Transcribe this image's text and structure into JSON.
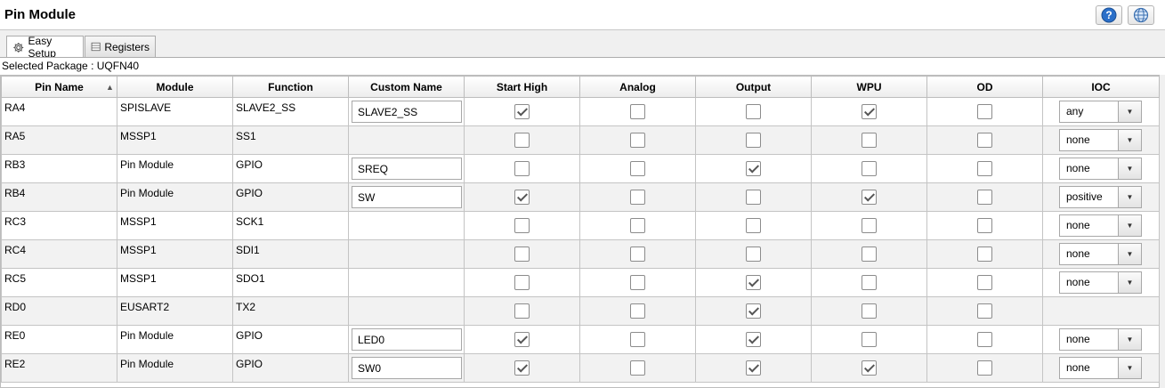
{
  "window": {
    "title": "Pin Module"
  },
  "toolbar": {
    "help_icon": "help-icon",
    "globe_icon": "globe-icon"
  },
  "tabs": [
    {
      "label": "Easy Setup",
      "icon": "gear-icon",
      "active": true
    },
    {
      "label": "Registers",
      "icon": "registers-icon",
      "active": false
    }
  ],
  "package": {
    "label": "Selected Package : UQFN40"
  },
  "columns": [
    "Pin Name",
    "Module",
    "Function",
    "Custom Name",
    "Start High",
    "Analog",
    "Output",
    "WPU",
    "OD",
    "IOC"
  ],
  "sort": {
    "column": "Pin Name",
    "direction": "ascending"
  },
  "rows": [
    {
      "pin": "RA4",
      "module": "SPISLAVE",
      "function": "SLAVE2_SS",
      "custom_name": "SLAVE2_SS",
      "start_high": true,
      "analog": false,
      "output": false,
      "wpu": true,
      "od": false,
      "ioc": "any"
    },
    {
      "pin": "RA5",
      "module": "MSSP1",
      "function": "SS1",
      "custom_name": null,
      "start_high": false,
      "analog": false,
      "output": false,
      "wpu": false,
      "od": false,
      "ioc": "none"
    },
    {
      "pin": "RB3",
      "module": "Pin Module",
      "function": "GPIO",
      "custom_name": "SREQ",
      "start_high": false,
      "analog": false,
      "output": true,
      "wpu": false,
      "od": false,
      "ioc": "none"
    },
    {
      "pin": "RB4",
      "module": "Pin Module",
      "function": "GPIO",
      "custom_name": "SW",
      "start_high": true,
      "analog": false,
      "output": false,
      "wpu": true,
      "od": false,
      "ioc": "positive"
    },
    {
      "pin": "RC3",
      "module": "MSSP1",
      "function": "SCK1",
      "custom_name": null,
      "start_high": false,
      "analog": false,
      "output": false,
      "wpu": false,
      "od": false,
      "ioc": "none"
    },
    {
      "pin": "RC4",
      "module": "MSSP1",
      "function": "SDI1",
      "custom_name": null,
      "start_high": false,
      "analog": false,
      "output": false,
      "wpu": false,
      "od": false,
      "ioc": "none"
    },
    {
      "pin": "RC5",
      "module": "MSSP1",
      "function": "SDO1",
      "custom_name": null,
      "start_high": false,
      "analog": false,
      "output": true,
      "wpu": false,
      "od": false,
      "ioc": "none"
    },
    {
      "pin": "RD0",
      "module": "EUSART2",
      "function": "TX2",
      "custom_name": null,
      "start_high": false,
      "analog": false,
      "output": true,
      "wpu": false,
      "od": false,
      "ioc": null
    },
    {
      "pin": "RE0",
      "module": "Pin Module",
      "function": "GPIO",
      "custom_name": "LED0",
      "start_high": true,
      "analog": false,
      "output": true,
      "wpu": false,
      "od": false,
      "ioc": "none"
    },
    {
      "pin": "RE2",
      "module": "Pin Module",
      "function": "GPIO",
      "custom_name": "SW0",
      "start_high": true,
      "analog": false,
      "output": true,
      "wpu": true,
      "od": false,
      "ioc": "none"
    }
  ]
}
